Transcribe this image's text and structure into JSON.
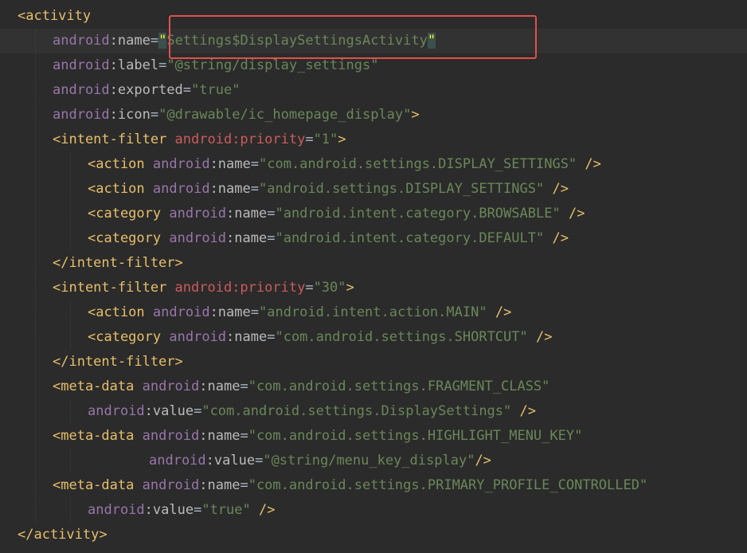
{
  "editor": {
    "language": "xml",
    "lines": [
      {
        "indent": 0,
        "tokens": [
          [
            "tag",
            "<activity"
          ]
        ]
      },
      {
        "indent": 1,
        "current": true,
        "tokens": [
          [
            "ns",
            "android"
          ],
          [
            "attr",
            ":name"
          ],
          [
            "plain",
            "="
          ],
          [
            "bracket",
            "\""
          ],
          [
            "str",
            "Settings$DisplaySettingsActivity"
          ],
          [
            "bracket",
            "\""
          ]
        ]
      },
      {
        "indent": 1,
        "tokens": [
          [
            "ns",
            "android"
          ],
          [
            "attr",
            ":label"
          ],
          [
            "plain",
            "="
          ],
          [
            "str",
            "\"@string/display_settings\""
          ]
        ]
      },
      {
        "indent": 1,
        "tokens": [
          [
            "ns",
            "android"
          ],
          [
            "attr",
            ":exported"
          ],
          [
            "plain",
            "="
          ],
          [
            "str",
            "\"true\""
          ]
        ]
      },
      {
        "indent": 1,
        "tokens": [
          [
            "ns",
            "android"
          ],
          [
            "attr",
            ":icon"
          ],
          [
            "plain",
            "="
          ],
          [
            "str",
            "\"@drawable/ic_homepage_display\""
          ],
          [
            "tag",
            ">"
          ]
        ]
      },
      {
        "indent": 1,
        "tokens": [
          [
            "tag",
            "<intent-filter"
          ],
          [
            "plain",
            " "
          ],
          [
            "warn",
            "android:priority"
          ],
          [
            "plain",
            "="
          ],
          [
            "str",
            "\"1\""
          ],
          [
            "tag",
            ">"
          ]
        ]
      },
      {
        "indent": 2,
        "tokens": [
          [
            "tag",
            "<action"
          ],
          [
            "plain",
            " "
          ],
          [
            "ns",
            "android"
          ],
          [
            "attr",
            ":name"
          ],
          [
            "plain",
            "="
          ],
          [
            "str",
            "\"com.android.settings.DISPLAY_SETTINGS\""
          ],
          [
            "plain",
            " "
          ],
          [
            "tag",
            "/>"
          ]
        ]
      },
      {
        "indent": 2,
        "tokens": [
          [
            "tag",
            "<action"
          ],
          [
            "plain",
            " "
          ],
          [
            "ns",
            "android"
          ],
          [
            "attr",
            ":name"
          ],
          [
            "plain",
            "="
          ],
          [
            "str",
            "\"android.settings.DISPLAY_SETTINGS\""
          ],
          [
            "plain",
            " "
          ],
          [
            "tag",
            "/>"
          ]
        ]
      },
      {
        "indent": 2,
        "tokens": [
          [
            "tag",
            "<category"
          ],
          [
            "plain",
            " "
          ],
          [
            "ns",
            "android"
          ],
          [
            "attr",
            ":name"
          ],
          [
            "plain",
            "="
          ],
          [
            "str",
            "\"android.intent.category.BROWSABLE\""
          ],
          [
            "plain",
            " "
          ],
          [
            "tag",
            "/>"
          ]
        ]
      },
      {
        "indent": 2,
        "tokens": [
          [
            "tag",
            "<category"
          ],
          [
            "plain",
            " "
          ],
          [
            "ns",
            "android"
          ],
          [
            "attr",
            ":name"
          ],
          [
            "plain",
            "="
          ],
          [
            "str",
            "\"android.intent.category.DEFAULT\""
          ],
          [
            "plain",
            " "
          ],
          [
            "tag",
            "/>"
          ]
        ]
      },
      {
        "indent": 1,
        "tokens": [
          [
            "tag",
            "</intent-filter>"
          ]
        ]
      },
      {
        "indent": 1,
        "tokens": [
          [
            "tag",
            "<intent-filter"
          ],
          [
            "plain",
            " "
          ],
          [
            "warn",
            "android:priority"
          ],
          [
            "plain",
            "="
          ],
          [
            "str",
            "\"30\""
          ],
          [
            "tag",
            ">"
          ]
        ]
      },
      {
        "indent": 2,
        "tokens": [
          [
            "tag",
            "<action"
          ],
          [
            "plain",
            " "
          ],
          [
            "ns",
            "android"
          ],
          [
            "attr",
            ":name"
          ],
          [
            "plain",
            "="
          ],
          [
            "str",
            "\"android.intent.action.MAIN\""
          ],
          [
            "plain",
            " "
          ],
          [
            "tag",
            "/>"
          ]
        ]
      },
      {
        "indent": 2,
        "tokens": [
          [
            "tag",
            "<category"
          ],
          [
            "plain",
            " "
          ],
          [
            "ns",
            "android"
          ],
          [
            "attr",
            ":name"
          ],
          [
            "plain",
            "="
          ],
          [
            "str",
            "\"com.android.settings.SHORTCUT\""
          ],
          [
            "plain",
            " "
          ],
          [
            "tag",
            "/>"
          ]
        ]
      },
      {
        "indent": 1,
        "tokens": [
          [
            "tag",
            "</intent-filter>"
          ]
        ]
      },
      {
        "indent": 1,
        "tokens": [
          [
            "tag",
            "<meta-data"
          ],
          [
            "plain",
            " "
          ],
          [
            "ns",
            "android"
          ],
          [
            "attr",
            ":name"
          ],
          [
            "plain",
            "="
          ],
          [
            "str",
            "\"com.android.settings.FRAGMENT_CLASS\""
          ]
        ]
      },
      {
        "indent": 2,
        "tokens": [
          [
            "ns",
            "android"
          ],
          [
            "attr",
            ":value"
          ],
          [
            "plain",
            "="
          ],
          [
            "str",
            "\"com.android.settings.DisplaySettings\""
          ],
          [
            "plain",
            " "
          ],
          [
            "tag",
            "/>"
          ]
        ]
      },
      {
        "indent": 1,
        "tokens": [
          [
            "tag",
            "<meta-data"
          ],
          [
            "plain",
            " "
          ],
          [
            "ns",
            "android"
          ],
          [
            "attr",
            ":name"
          ],
          [
            "plain",
            "="
          ],
          [
            "str",
            "\"com.android.settings.HIGHLIGHT_MENU_KEY\""
          ]
        ]
      },
      {
        "indent": 3.75,
        "tokens": [
          [
            "ns",
            "android"
          ],
          [
            "attr",
            ":value"
          ],
          [
            "plain",
            "="
          ],
          [
            "str",
            "\"@string/menu_key_display\""
          ],
          [
            "tag",
            "/>"
          ]
        ]
      },
      {
        "indent": 1,
        "tokens": [
          [
            "tag",
            "<meta-data"
          ],
          [
            "plain",
            " "
          ],
          [
            "ns",
            "android"
          ],
          [
            "attr",
            ":name"
          ],
          [
            "plain",
            "="
          ],
          [
            "str",
            "\"com.android.settings.PRIMARY_PROFILE_CONTROLLED\""
          ]
        ]
      },
      {
        "indent": 2,
        "tokens": [
          [
            "ns",
            "android"
          ],
          [
            "attr",
            ":value"
          ],
          [
            "plain",
            "="
          ],
          [
            "str",
            "\"true\""
          ],
          [
            "plain",
            " "
          ],
          [
            "tag",
            "/>"
          ]
        ]
      },
      {
        "indent": 0,
        "tokens": [
          [
            "tag",
            "</activity>"
          ]
        ]
      }
    ]
  },
  "colors": {
    "background": "#2b2b2b",
    "current_line": "#323232",
    "tag": "#e8bf6a",
    "namespace": "#9876aa",
    "string": "#6a8759",
    "warning_attr": "#cc5b5b",
    "highlight_box": "#e0504b"
  }
}
